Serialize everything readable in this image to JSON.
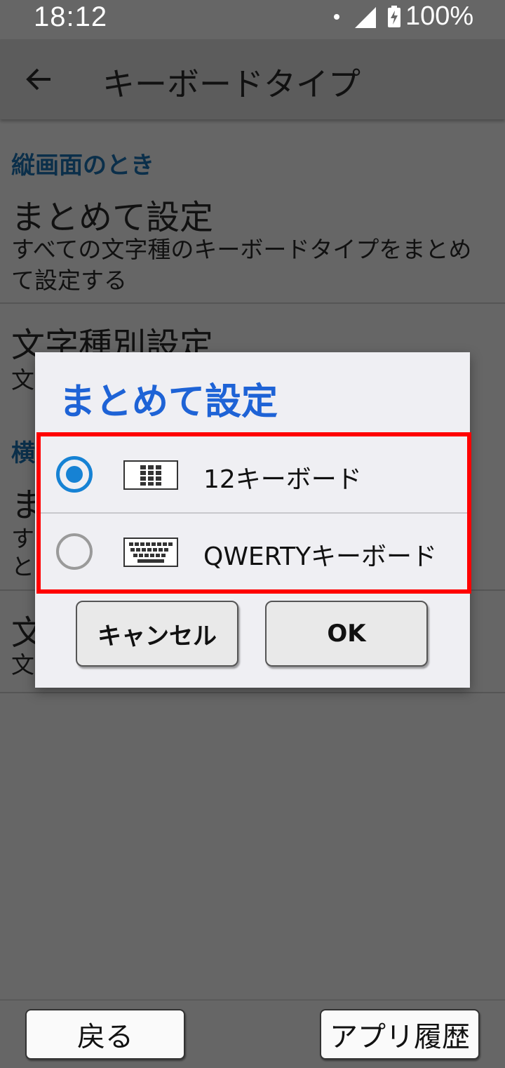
{
  "status_bar": {
    "time": "18:12",
    "battery": "100%"
  },
  "app_bar": {
    "title": "キーボードタイプ"
  },
  "background_list": {
    "portrait_header": "縦画面のとき",
    "bulk_title": "まとめて設定",
    "bulk_desc": "すべての文字種のキーボードタイプをまとめて設定する",
    "type_title": "文字種別設定",
    "type_desc_partial": "文",
    "landscape_header_partial": "横",
    "landscape_bulk_partial": "ま",
    "landscape_desc_partial_1": "す",
    "landscape_desc_partial_2": "と",
    "landscape_type_partial": "文",
    "landscape_type_desc_partial": "文"
  },
  "dialog": {
    "title": "まとめて設定",
    "options": [
      {
        "label": "12キーボード",
        "selected": true,
        "icon": "keypad-12-icon"
      },
      {
        "label": "QWERTYキーボード",
        "selected": false,
        "icon": "qwerty-keyboard-icon"
      }
    ],
    "cancel_label": "キャンセル",
    "ok_label": "OK"
  },
  "bottom_nav": {
    "back_label": "戻る",
    "history_label": "アプリ履歴"
  },
  "colors": {
    "accent": "#1682d4",
    "dialog_title": "#1e63d6",
    "highlight": "#ff0000",
    "scrim": "#666666"
  }
}
